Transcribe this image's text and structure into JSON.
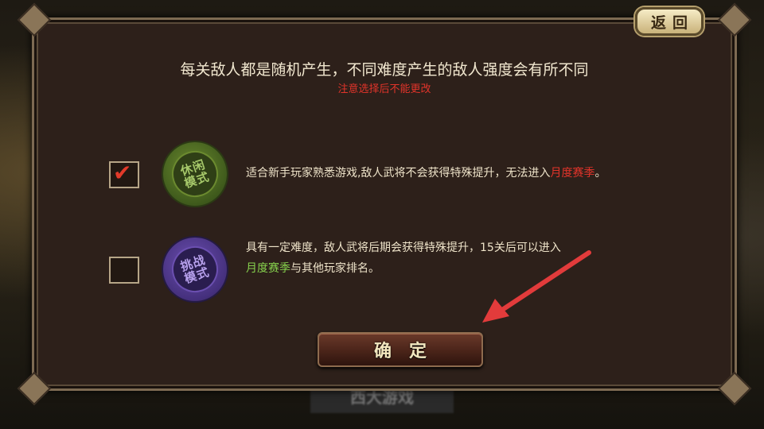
{
  "background": {
    "strip_text": "西大游戏"
  },
  "dialog": {
    "title": "每关敌人都是随机产生，不同难度产生的敌人强度会有所不同",
    "warning": "注意选择后不能更改",
    "options": [
      {
        "checked": true,
        "badge_text": "休闲模式",
        "badge_color": "#4f6f22",
        "desc_main": "适合新手玩家熟悉游戏,敌人武将不会获得特殊提升，无法进入",
        "desc_highlight": "月度赛季",
        "desc_tail": "。",
        "highlight_color": "#e2342a"
      },
      {
        "checked": false,
        "badge_text": "挑战模式",
        "badge_color": "#4a3489",
        "desc_main": "具有一定难度，敌人武将后期会获得特殊提升，15关后可以进入",
        "desc_highlight": "月度赛季",
        "desc_tail": "与其他玩家排名。",
        "highlight_color": "#86d14d"
      }
    ],
    "confirm_label": "确定"
  },
  "back_label": "返回",
  "annotation": {
    "arrow_color": "#e23b3b"
  }
}
